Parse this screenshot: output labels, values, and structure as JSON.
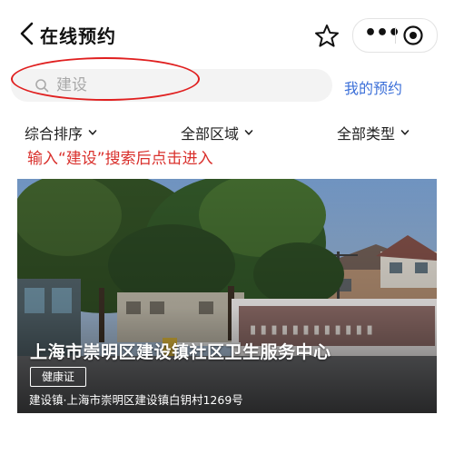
{
  "header": {
    "title": "在线预约",
    "back_icon": "chevron-left-icon",
    "favorite_icon": "star-outline-icon",
    "more_icon": "more-dots-icon",
    "close_icon": "target-circle-icon"
  },
  "search": {
    "placeholder": "建设",
    "my_booking_label": "我的预约",
    "annotation_color": "#e02020"
  },
  "filters": [
    {
      "label": "综合排序"
    },
    {
      "label": "全部区域"
    },
    {
      "label": "全部类型"
    }
  ],
  "hint": {
    "text": "输入“建设”搜索后点击进入",
    "color": "#d9302c"
  },
  "cards": [
    {
      "title": "上海市崇明区建设镇社区卫生服务中心",
      "tag": "健康证",
      "address": "建设镇·上海市崇明区建设镇白钥村1269号"
    }
  ],
  "colors": {
    "accent": "#3b6fd8"
  }
}
